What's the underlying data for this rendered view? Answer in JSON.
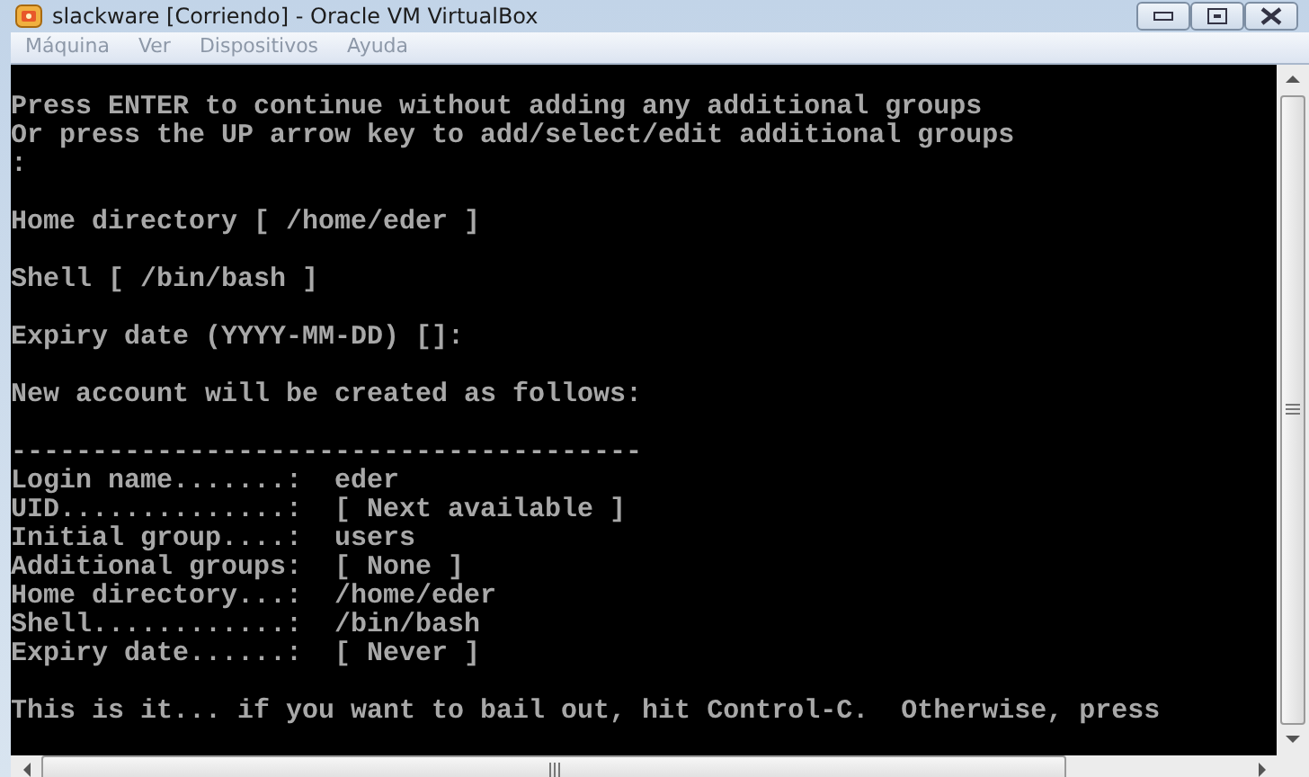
{
  "window": {
    "title": "slackware [Corriendo] - Oracle VM VirtualBox"
  },
  "menu": [
    "Máquina",
    "Ver",
    "Dispositivos",
    "Ayuda"
  ],
  "console": {
    "paragraphs": [
      [
        "Press ENTER to continue without adding any additional groups",
        "Or press the UP arrow key to add/select/edit additional groups",
        ":"
      ],
      [
        "Home directory [ /home/eder ]"
      ],
      [
        "Shell [ /bin/bash ]"
      ],
      [
        "Expiry date (YYYY-MM-DD) []:"
      ],
      [
        "New account will be created as follows:"
      ],
      [
        "---------------------------------------",
        "Login name.......:  eder",
        "UID..............:  [ Next available ]",
        "Initial group....:  users",
        "Additional groups:  [ None ]",
        "Home directory...:  /home/eder",
        "Shell............:  /bin/bash",
        "Expiry date......:  [ Never ]"
      ],
      [
        "This is it... if you want to bail out, hit Control-C.  Otherwise, press"
      ]
    ]
  }
}
